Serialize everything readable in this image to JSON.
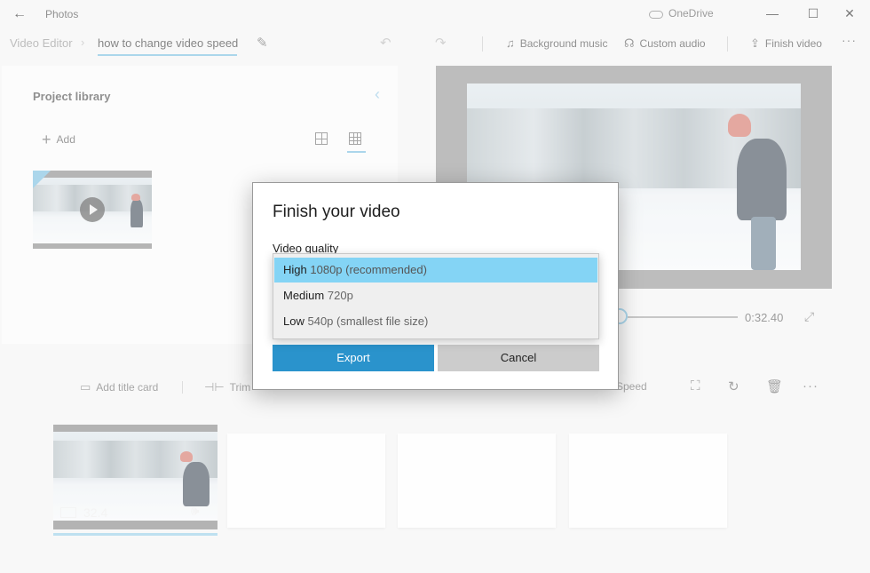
{
  "titlebar": {
    "back": "←",
    "app_name": "Photos",
    "onedrive": "OneDrive",
    "minimize": "—",
    "maximize": "☐",
    "close": "✕"
  },
  "commandbar": {
    "breadcrumb_root": "Video Editor",
    "breadcrumb_sep": "›",
    "project_name": "how to change video speed",
    "background_music": "Background music",
    "custom_audio": "Custom audio",
    "finish_video": "Finish video",
    "more": "···"
  },
  "library": {
    "title": "Project library",
    "add": "Add"
  },
  "player": {
    "total_time": "0:32.40"
  },
  "storyboard": {
    "add_title_card": "Add title card",
    "trim": "Trim",
    "speed": "Speed",
    "more": "···",
    "clip_duration": "32.4"
  },
  "dialog": {
    "title": "Finish your video",
    "quality_label": "Video quality",
    "options": [
      {
        "name": "High",
        "detail": "1080p (recommended)",
        "selected": true
      },
      {
        "name": "Medium",
        "detail": "720p",
        "selected": false
      },
      {
        "name": "Low",
        "detail": "540p (smallest file size)",
        "selected": false
      }
    ],
    "export": "Export",
    "cancel": "Cancel"
  }
}
